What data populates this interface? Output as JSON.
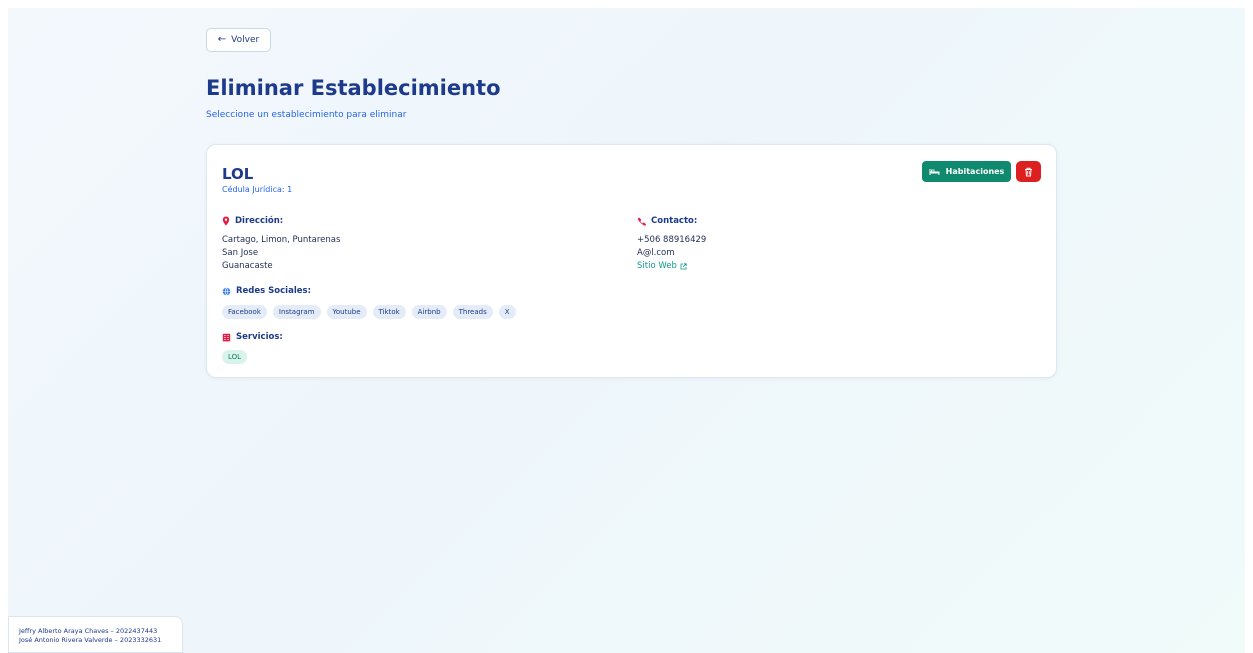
{
  "header": {
    "back_label": "Volver",
    "title": "Eliminar Establecimiento",
    "subtitle": "Seleccione un establecimiento para eliminar"
  },
  "establishment": {
    "name": "LOL",
    "cedula": "Cédula Jurídica: 1",
    "rooms_label": "Habitaciones",
    "address": {
      "heading": "Dirección:",
      "lines": [
        "Cartago, Limon, Puntarenas",
        "San Jose",
        "Guanacaste"
      ]
    },
    "contact": {
      "heading": "Contacto:",
      "phone": "+506 88916429",
      "email": "A@l.com",
      "website_label": "Sitio Web"
    },
    "social": {
      "heading": "Redes Sociales:",
      "items": [
        "Facebook",
        "Instagram",
        "Youtube",
        "Tiktok",
        "Airbnb",
        "Threads",
        "X"
      ]
    },
    "services": {
      "heading": "Servicios:",
      "items": [
        "LOL"
      ]
    }
  },
  "footer": {
    "line1": "Jeffry Alberto Araya Chaves – 2022437443",
    "line2": "José Antonio Rivera Valverde – 2023332631"
  },
  "colors": {
    "primary": "#1e3a8a",
    "accent_link": "#0e9b8f",
    "rooms_button": "#0f8a6f",
    "delete_button": "#dc1f1f",
    "location_pin": "#e11d48",
    "phone_icon": "#e11d48"
  }
}
